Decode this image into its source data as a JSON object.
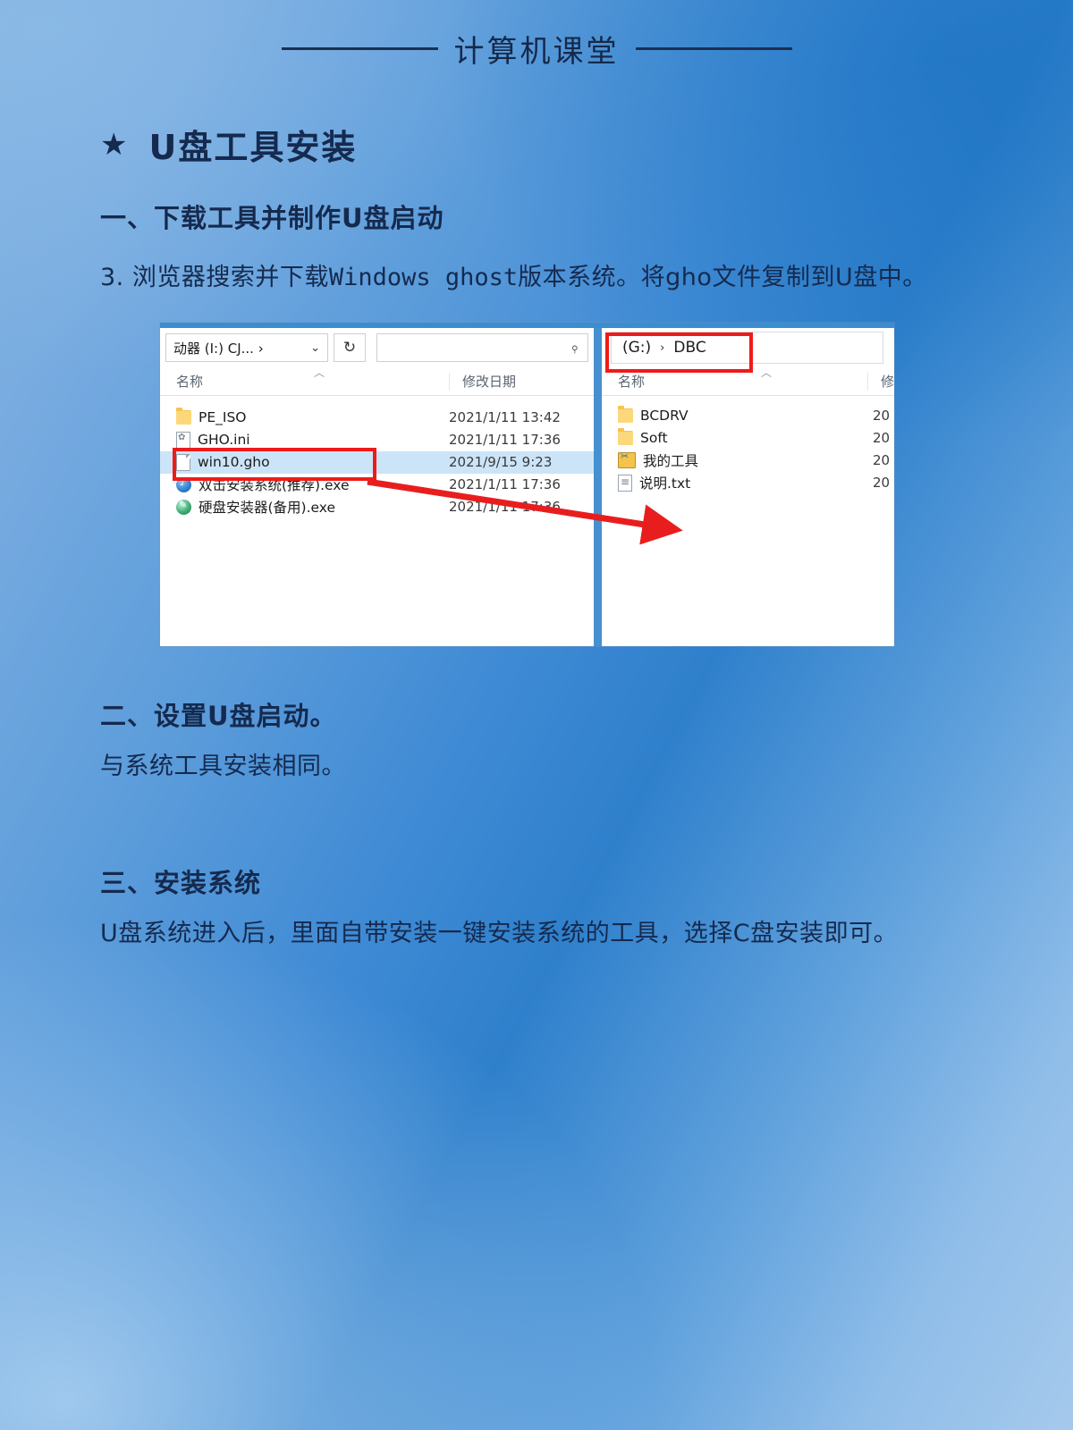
{
  "header": {
    "title": "计算机课堂"
  },
  "main_title": {
    "star": "★",
    "text": "U盘工具安装"
  },
  "sections": {
    "one": {
      "heading": "一、下载工具并制作U盘启动",
      "paragraph_prefix": "3. 浏览器搜索并下载",
      "paragraph_mono": "Windows ghost",
      "paragraph_suffix": "版本系统。将gho文件复制到U盘中。"
    },
    "two": {
      "heading": "二、设置U盘启动。",
      "body": "与系统工具安装相同。"
    },
    "three": {
      "heading": "三、安装系统",
      "body": "U盘系统进入后，里面自带安装一键安装系统的工具，选择C盘安装即可。"
    }
  },
  "explorer": {
    "left_pane": {
      "address": "动器 (I:) CJ...",
      "address_separator": "›",
      "dropdown_icon": "⌄",
      "refresh_icon": "↻",
      "search_placeholder": "",
      "search_icon": "⌕",
      "columns": [
        "名称",
        "修改日期"
      ],
      "sort_caret": "︿",
      "rows": [
        {
          "name": "PE_ISO",
          "icon": "folder",
          "date": "2021/1/11 13:42",
          "selected": false
        },
        {
          "name": "GHO.ini",
          "icon": "ini",
          "date": "2021/1/11 17:36",
          "selected": false
        },
        {
          "name": "win10.gho",
          "icon": "doc",
          "date": "2021/9/15 9:23",
          "selected": true
        },
        {
          "name": "双击安装系统(推荐).exe",
          "icon": "exe-blue",
          "date": "2021/1/11 17:36",
          "selected": false
        },
        {
          "name": "硬盘安装器(备用).exe",
          "icon": "exe-green",
          "date": "2021/1/11 17:36",
          "selected": false
        }
      ]
    },
    "right_pane": {
      "address_drive": "(G:)",
      "address_separator": "›",
      "address_folder": "DBC",
      "columns": [
        "名称",
        "修"
      ],
      "sort_caret": "︿",
      "rows": [
        {
          "name": "BCDRV",
          "icon": "folder",
          "date": "20"
        },
        {
          "name": "Soft",
          "icon": "folder",
          "date": "20"
        },
        {
          "name": "我的工具",
          "icon": "tools",
          "date": "20"
        },
        {
          "name": "说明.txt",
          "icon": "txt",
          "date": "20"
        }
      ]
    },
    "annotations": {
      "highlight_color": "#ee1b1b",
      "arrow_color": "#e81e1e",
      "highlight_target_left": "win10.gho",
      "highlight_target_right": "(G:) › DBC"
    }
  },
  "colors": {
    "background_top_left": "#7aaadd",
    "background_top_right": "#2a7cc7",
    "background_bottom_left": "#a3c8ea",
    "background_bottom_right": "#6cabe0",
    "text": "#152a4e",
    "selection": "#cce4f7"
  }
}
